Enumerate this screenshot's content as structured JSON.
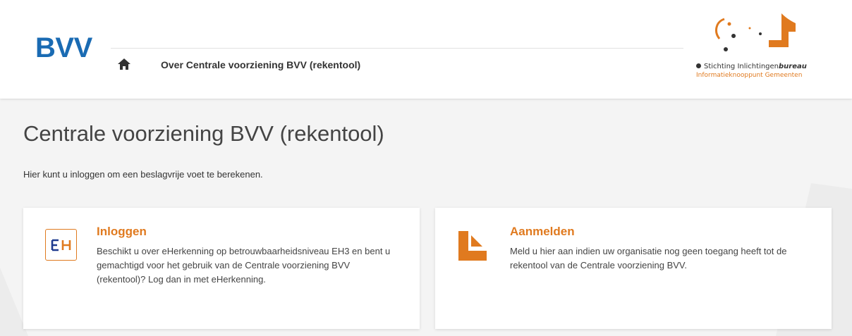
{
  "header": {
    "brand": "BVV",
    "nav_link": "Over Centrale voorziening BVV (rekentool)",
    "logo": {
      "line1_regular": "Stichting Inlichtingen",
      "line1_bold": "bureau",
      "line2": "Informatieknooppunt Gemeenten"
    }
  },
  "main": {
    "title": "Centrale voorziening BVV (rekentool)",
    "intro": "Hier kunt u inloggen om een beslagvrije voet te berekenen.",
    "cards": [
      {
        "title": "Inloggen",
        "icon": "eherkenning-icon",
        "icon_text": "EH",
        "text": "Beschikt u over eHerkenning op betrouwbaarheidsniveau EH3 en bent u gemachtigd voor het gebruik van de Centrale voorziening BVV (rekentool)? Log dan in met eHerkenning."
      },
      {
        "title": "Aanmelden",
        "icon": "document-icon",
        "text": "Meld u hier aan indien uw organisatie nog geen toegang heeft tot de rekentool van de Centrale voorziening BVV."
      }
    ]
  },
  "colors": {
    "brand_blue": "#1a6bb3",
    "accent_orange": "#e07a1f",
    "eh_blue": "#1f3b8f"
  }
}
